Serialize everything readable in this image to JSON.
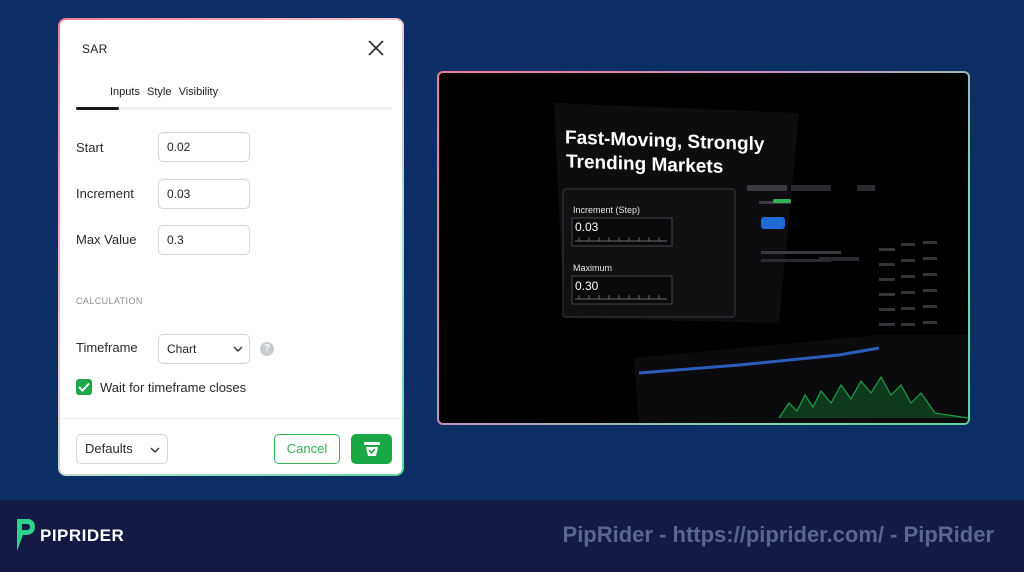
{
  "dialog": {
    "title": "SAR",
    "tabs": [
      "Inputs",
      "Style",
      "Visibility"
    ],
    "fields": [
      {
        "label": "Start",
        "value": "0.02"
      },
      {
        "label": "Increment",
        "value": "0.03"
      },
      {
        "label": "Max Value",
        "value": "0.3"
      }
    ],
    "section": "CALCULATION",
    "timeframe": {
      "label": "Timeframe",
      "value": "Chart"
    },
    "help_symbol": "?",
    "checkbox": {
      "label": "Wait for timeframe closes",
      "checked": true
    },
    "footer": {
      "defaults_label": "Defaults",
      "cancel_label": "Cancel"
    }
  },
  "video": {
    "headline_line1": "Fast-Moving, Strongly",
    "headline_line2": "Trending Markets",
    "increment_label": "Increment (Step)",
    "increment_value": "0.03",
    "maximum_label": "Maximum",
    "maximum_value": "0.30"
  },
  "banner": {
    "logo_text": "PIPRIDER",
    "watermark": "PipRider - https://piprider.com/ - PipRider"
  },
  "colors": {
    "background": "#0b2f64",
    "accent_green": "#1aa844",
    "banner": "#141945"
  }
}
